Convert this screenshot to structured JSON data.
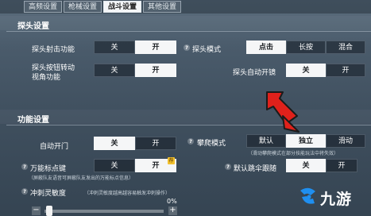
{
  "tabs": [
    {
      "label": "高频设置"
    },
    {
      "label": "枪械设置"
    },
    {
      "label": "战斗设置"
    },
    {
      "label": "其他设置"
    }
  ],
  "scope": {
    "title": "探头设置",
    "shoot": {
      "label": "探头射击功能",
      "options": [
        "关",
        "开"
      ],
      "selected": "开"
    },
    "mode": {
      "label": "探头模式",
      "options": [
        "点击",
        "长按",
        "混合"
      ],
      "selected": "点击"
    },
    "rotate": {
      "label_line1": "探头按钮转动",
      "label_line2": "视角功能",
      "options": [
        "关",
        "开"
      ],
      "selected": "开"
    },
    "auto_scope": {
      "label": "探头自动开镜",
      "options": [
        "关",
        "开"
      ],
      "selected": "关"
    }
  },
  "features": {
    "title": "功能设置",
    "auto_door": {
      "label": "自动开门",
      "options": [
        "关",
        "开"
      ],
      "selected": "关"
    },
    "climb": {
      "label": "攀爬模式",
      "options": [
        "默认",
        "独立",
        "滑动"
      ],
      "selected": "独立",
      "hint": "（滑动攀爬模式在部分技能玩法中将失效）"
    },
    "marker": {
      "label": "万能标点键",
      "options": [
        "关",
        "开"
      ],
      "selected": "开",
      "hint": "（屏蔽队友语音可屏蔽队友发出的万能标点信息）"
    },
    "follow": {
      "label": "默认跳伞跟随",
      "options": [
        "关",
        "开"
      ],
      "selected": "关"
    },
    "sprint": {
      "label": "冲刺灵敏度",
      "hint": "（冲刺灵敏度越高越容易触发冲刺操作）",
      "value_percent": 0,
      "value_text": "0%",
      "minus": "−",
      "plus": "+"
    }
  },
  "watermark": {
    "text": "九游"
  },
  "colors": {
    "arrow": "#e0211b",
    "selected_bg": "#f5f6f7",
    "logo_blue": "#1f8ff0"
  }
}
